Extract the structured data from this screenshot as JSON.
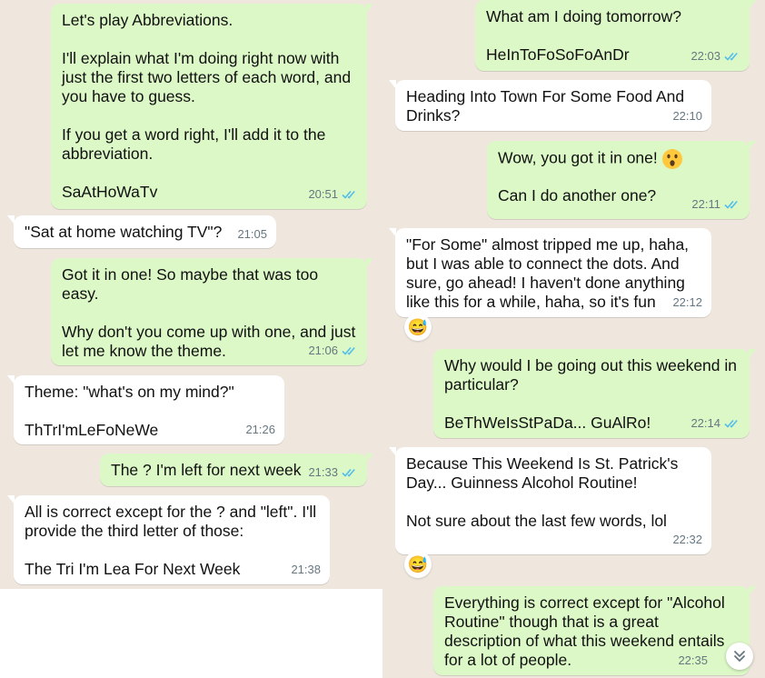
{
  "chat_left": {
    "messages": [
      {
        "dir": "out",
        "text": "Let's play Abbreviations.\n\nI'll explain what I'm doing right now with just the first two letters of each word, and you have to guess.\n\nIf you get a word right, I'll add it to the abbreviation.\n\nSaAtHoWaTv",
        "time": "20:51",
        "read": true
      },
      {
        "dir": "in",
        "text": "\"Sat at home watching TV\"?",
        "time": "21:05"
      },
      {
        "dir": "out",
        "text": "Got it in one! So maybe that was too easy.\n\nWhy don't you come up with one, and just let me know the theme.",
        "time": "21:06",
        "read": true
      },
      {
        "dir": "in",
        "text": "Theme: \"what's on my mind?\"\n\nThTrI'mLeFoNeWe",
        "time": "21:26"
      },
      {
        "dir": "out",
        "text": "The ? I'm left for next week",
        "time": "21:33",
        "read": true
      },
      {
        "dir": "in",
        "text": "All is correct except for the ? and \"left\". I'll provide the third letter of those:\n\nThe Tri I'm Lea For Next Week",
        "time": "21:38"
      }
    ]
  },
  "chat_right": {
    "messages": [
      {
        "dir": "out",
        "text": "What am I doing tomorrow?\n\nHeInToFoSoFoAnDr",
        "time": "22:03",
        "read": true
      },
      {
        "dir": "in",
        "text": "Heading Into Town For Some Food And Drinks?",
        "time": "22:10"
      },
      {
        "dir": "out",
        "text": "Wow, you got it in one!",
        "text2": "Can I do another one?",
        "time": "22:11",
        "read": true,
        "emoji": "astonished-face"
      },
      {
        "dir": "in",
        "text": "\"For Some\" almost tripped me up, haha, but I was able to connect the dots. And sure, go ahead! I haven't done anything like this for a while, haha, so it's fun",
        "time": "22:12",
        "reaction": "grinning-sweat-face"
      },
      {
        "dir": "out",
        "text": "Why would I be going out this weekend in particular?\n\nBeThWeIsStPaDa... GuAlRo!",
        "time": "22:14",
        "read": true
      },
      {
        "dir": "in",
        "text": "Because This Weekend Is St. Patrick's Day... Guinness Alcohol Routine!\n\nNot sure about the last few words, lol",
        "time": "22:32",
        "reaction": "grinning-sweat-face"
      },
      {
        "dir": "out",
        "text": "Everything is correct except for \"Alcohol Routine\" though that is a great description of what this weekend entails for a lot of people.",
        "time": "22:35",
        "read": true
      }
    ]
  },
  "reaction_emoji": "😅",
  "colors": {
    "outgoing": "#dcf8c6",
    "incoming": "#ffffff",
    "tick": "#53bdeb",
    "meta": "#667781",
    "background": "#efe7de"
  }
}
